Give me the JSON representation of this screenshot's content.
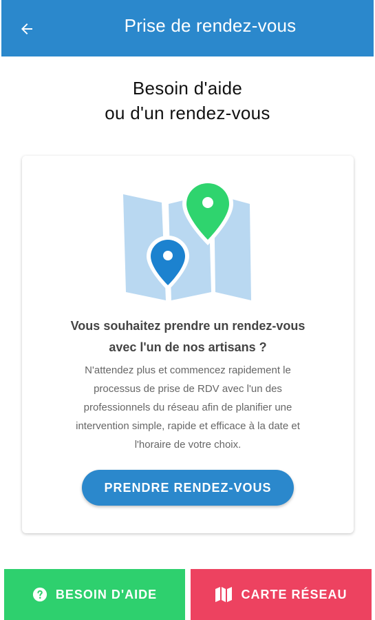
{
  "header": {
    "title": "Prise de rendez-vous",
    "back_icon": "arrow-left-icon",
    "background": "#2b88cc"
  },
  "heading": {
    "line1": "Besoin d'aide",
    "line2": "ou d'un rendez-vous"
  },
  "card": {
    "illustration_icon": "map-pins-illustration",
    "title_line1": "Vous souhaitez prendre un rendez-vous",
    "title_line2": "avec l'un de nos artisans ?",
    "description": [
      "N'attendez plus et commencez rapidement le",
      "processus de prise de RDV avec l'un des",
      "professionnels du réseau afin de planifier une",
      "intervention simple, rapide et efficace à la date et",
      "l'horaire de votre choix."
    ],
    "cta_label": "PRENDRE RENDEZ-VOUS"
  },
  "bottom": {
    "help": {
      "label": "BESOIN D'AIDE",
      "icon": "question-circle-icon",
      "color": "#2ed06e"
    },
    "map": {
      "label": "CARTE RÉSEAU",
      "icon": "map-icon",
      "color": "#ed4260"
    }
  }
}
